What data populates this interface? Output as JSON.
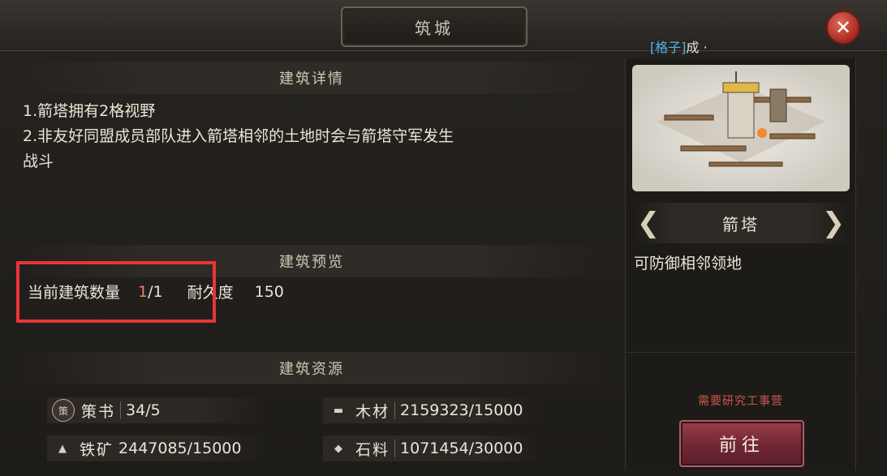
{
  "window": {
    "title": "筑城",
    "close_label": "✕"
  },
  "tag": {
    "highlight": "[格子]",
    "text": "成 ·"
  },
  "details": {
    "header": "建筑详情",
    "lines": [
      "1.箭塔拥有2格视野",
      "2.非友好同盟成员部队进入箭塔相邻的土地时会与箭塔守军发生",
      "战斗"
    ]
  },
  "preview": {
    "header": "建筑预览",
    "count_label": "当前建筑数量",
    "count_current": "1",
    "count_sep": "/1",
    "durability_label": "耐久度",
    "durability_value": "150"
  },
  "resources": {
    "header": "建筑资源",
    "items": [
      {
        "icon": "book-icon",
        "glyph": "策",
        "name": "策书",
        "value": "34/5"
      },
      {
        "icon": "wood-icon",
        "glyph": "▬",
        "name": "木材",
        "value": "2159323/15000"
      },
      {
        "icon": "iron-icon",
        "glyph": "▲",
        "name": "铁矿",
        "value": "2447085/15000"
      },
      {
        "icon": "stone-icon",
        "glyph": "◆",
        "name": "石料",
        "value": "1071454/30000"
      }
    ]
  },
  "building": {
    "name": "箭塔",
    "description": "可防御相邻领地",
    "prev_label": "❮",
    "next_label": "❯",
    "requirement": "需要研究工事营",
    "go_label": "前往"
  },
  "colors": {
    "highlight_border": "#e8353a",
    "go_button": "#6e2733",
    "requirement_text": "#c7574b",
    "tag_highlight": "#4fb4e8"
  }
}
